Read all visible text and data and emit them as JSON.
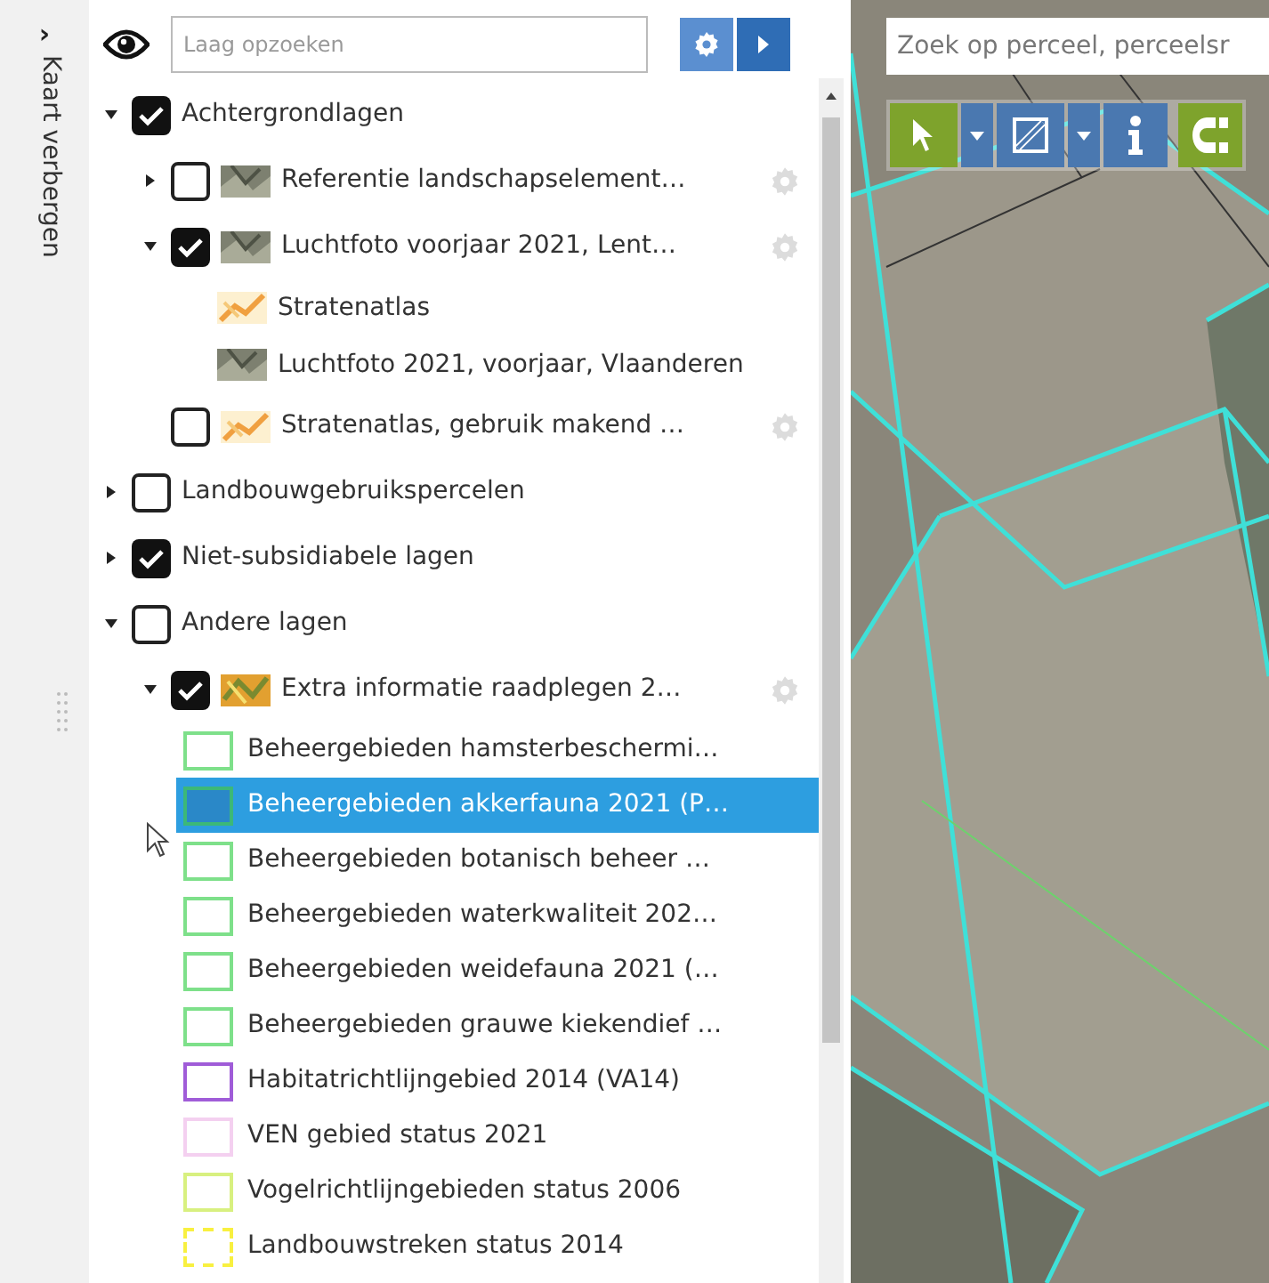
{
  "sidebar_toggle": {
    "label": "Kaart verbergen",
    "arrow": "›"
  },
  "layer_search": {
    "placeholder": "Laag opzoeken"
  },
  "layers": [
    {
      "kind": "group",
      "label": "Achtergrondlagen",
      "checked": true,
      "expanded": true,
      "children": [
        {
          "kind": "group",
          "label": "Referentie landschapselement…",
          "checked": false,
          "expanded": false,
          "thumbnail": {
            "kind": "aerial"
          },
          "settings": true
        },
        {
          "kind": "group",
          "label": "Luchtfoto voorjaar 2021, Lent…",
          "checked": true,
          "expanded": true,
          "thumbnail": {
            "kind": "aerial"
          },
          "settings": true,
          "children": [
            {
              "kind": "sublayer",
              "label": "Stratenatlas",
              "thumbnail": {
                "kind": "street"
              }
            },
            {
              "kind": "sublayer",
              "label": "Luchtfoto 2021, voorjaar, Vlaanderen",
              "thumbnail": {
                "kind": "aerial"
              }
            }
          ]
        },
        {
          "kind": "layer",
          "label": "Stratenatlas, gebruik makend …",
          "checked": false,
          "thumbnail": {
            "kind": "street"
          },
          "settings": true
        }
      ]
    },
    {
      "kind": "group",
      "label": "Landbouwgebruikspercelen",
      "checked": false,
      "expanded": false
    },
    {
      "kind": "group",
      "label": "Niet-subsidiabele lagen",
      "checked": true,
      "expanded": false
    },
    {
      "kind": "group",
      "label": "Andere lagen",
      "checked": false,
      "expanded": true,
      "children": [
        {
          "kind": "group",
          "label": "Extra informatie raadplegen 2…",
          "checked": true,
          "expanded": true,
          "thumbnail": {
            "kind": "mixed"
          },
          "settings": true,
          "children": [
            {
              "kind": "legend",
              "label": "Beheergebieden hamsterbeschermi…",
              "color": "#7ee08a",
              "selected": false
            },
            {
              "kind": "legend",
              "label": "Beheergebieden akkerfauna 2021 (P…",
              "color": "#3cb878",
              "selected": true
            },
            {
              "kind": "legend",
              "label": "Beheergebieden botanisch beheer …",
              "color": "#7ee08a",
              "selected": false
            },
            {
              "kind": "legend",
              "label": "Beheergebieden waterkwaliteit 202…",
              "color": "#7ee08a",
              "selected": false
            },
            {
              "kind": "legend",
              "label": "Beheergebieden weidefauna 2021 (…",
              "color": "#7ee08a",
              "selected": false
            },
            {
              "kind": "legend",
              "label": "Beheergebieden grauwe kiekendief …",
              "color": "#7ee08a",
              "selected": false
            },
            {
              "kind": "legend",
              "label": "Habitatrichtlijngebied 2014 (VA14)",
              "color": "#a05cd8",
              "selected": false
            },
            {
              "kind": "legend",
              "label": "VEN gebied status 2021",
              "color": "#f4d0f0",
              "selected": false
            },
            {
              "kind": "legend",
              "label": "Vogelrichtlijngebieden status 2006",
              "color": "#d8f080",
              "selected": false
            },
            {
              "kind": "legend",
              "label": "Landbouwstreken status 2014",
              "color": "#f8f040",
              "selected": false,
              "dashed": true
            }
          ]
        }
      ]
    }
  ],
  "map": {
    "search": {
      "placeholder": "Zoek op perceel, perceelsr"
    }
  }
}
